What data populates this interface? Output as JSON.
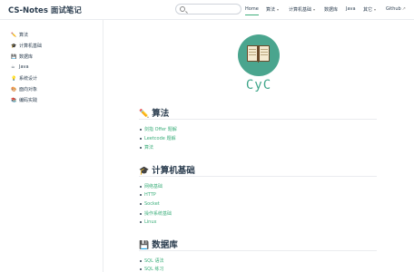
{
  "navbar": {
    "brand": "CS-Notes 面试笔记",
    "items": [
      {
        "label": "Home",
        "active": true
      },
      {
        "label": "算法",
        "dropdown": true
      },
      {
        "label": "计算机基础",
        "dropdown": true
      },
      {
        "label": "数据库"
      },
      {
        "label": "Java"
      },
      {
        "label": "其它",
        "dropdown": true
      },
      {
        "label": "Github",
        "external": true
      }
    ]
  },
  "sidebar": {
    "items": [
      {
        "icon": "✏️",
        "label": "算法"
      },
      {
        "icon": "🎓",
        "label": "计算机基础"
      },
      {
        "icon": "💾",
        "label": "数据库"
      },
      {
        "icon": "☕",
        "label": "Java"
      },
      {
        "icon": "💡",
        "label": "系统设计"
      },
      {
        "icon": "🎨",
        "label": "面向对象"
      },
      {
        "icon": "📚",
        "label": "编码实践"
      }
    ]
  },
  "hero": {
    "logo_text": "CyC"
  },
  "sections": [
    {
      "icon": "✏️",
      "title": "算法",
      "links": [
        "剑指 Offer 题解",
        "Leetcode 题解",
        "算法"
      ]
    },
    {
      "icon": "🎓",
      "title": "计算机基础",
      "links": [
        "网络基础",
        "HTTP",
        "Socket",
        "操作系统基础",
        "Linux"
      ]
    },
    {
      "icon": "💾",
      "title": "数据库",
      "links": [
        "SQL 语法",
        "SQL 练习"
      ]
    }
  ],
  "colors": {
    "accent": "#3eaf7c",
    "text": "#2c3e50",
    "logo_bg": "#4aa58e"
  }
}
